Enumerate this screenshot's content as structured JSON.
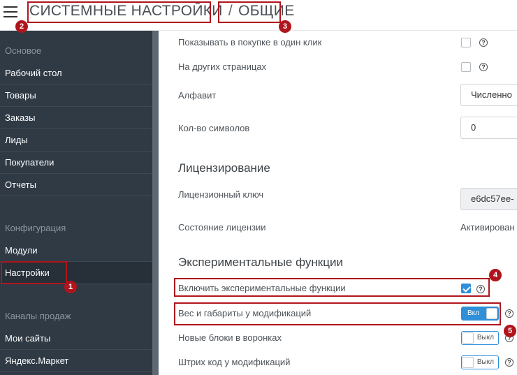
{
  "header": {
    "title_part1": "СИСТЕМНЫЕ НАСТРОЙКИ",
    "separator": "/",
    "title_part2": "ОБЩИЕ"
  },
  "sidebar": {
    "section_main": "Основое",
    "items_main": [
      "Рабочий стол",
      "Товары",
      "Заказы",
      "Лиды",
      "Покупатели",
      "Отчеты"
    ],
    "section_config": "Конфигурация",
    "items_config": [
      "Модули",
      "Настройки"
    ],
    "section_channels": "Каналы продаж",
    "items_channels": [
      "Мои сайты",
      "Яндекс.Маркет"
    ]
  },
  "main": {
    "rows_top": [
      {
        "label": "Показывать в покупке в один клик",
        "checked": false
      },
      {
        "label": "На других страницах",
        "checked": false
      }
    ],
    "alphabet_label": "Алфавит",
    "alphabet_value": "Численно",
    "chars_label": "Кол-во символов",
    "chars_value": "0",
    "licensing_heading": "Лицензирование",
    "license_key_label": "Лицензионный ключ",
    "license_key_value": "e6dc57ee-",
    "license_state_label": "Состояние лицензии",
    "license_state_value": "Активирован",
    "experimental_heading": "Экспериментальные функции",
    "exp_enable_label": "Включить экспериментальные функции",
    "exp_rows": [
      {
        "label": "Вес и габариты у модификаций",
        "state": "Вкл"
      },
      {
        "label": "Новые блоки в воронках",
        "state": "Выкл"
      },
      {
        "label": "Штрих код у модификаций",
        "state": "Выкл"
      }
    ],
    "help_glyph": "?"
  },
  "annotations": [
    "1",
    "2",
    "3",
    "4",
    "5"
  ],
  "colors": {
    "sidebar_bg": "#2f3a45",
    "accent": "#2f8fd8",
    "highlight": "#b0151d"
  }
}
